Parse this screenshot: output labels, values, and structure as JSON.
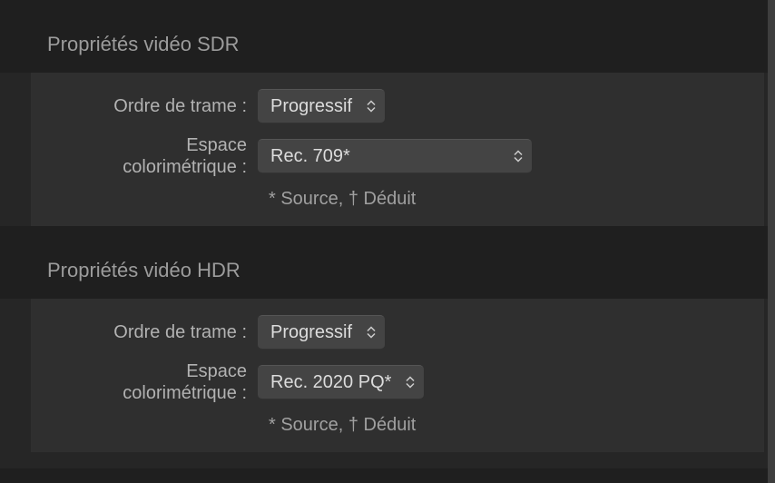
{
  "sections": {
    "sdr": {
      "title": "Propriétés vidéo SDR",
      "field_order_label": "Ordre de trame :",
      "field_order_value": "Progressif",
      "colorspace_label_line1": "Espace",
      "colorspace_label_line2": "colorimétrique :",
      "colorspace_value": "Rec. 709*",
      "footnote": "* Source, † Déduit"
    },
    "hdr": {
      "title": "Propriétés vidéo HDR",
      "field_order_label": "Ordre de trame :",
      "field_order_value": "Progressif",
      "colorspace_label_line1": "Espace",
      "colorspace_label_line2": "colorimétrique :",
      "colorspace_value": "Rec. 2020 PQ*",
      "footnote": "* Source, † Déduit"
    }
  }
}
